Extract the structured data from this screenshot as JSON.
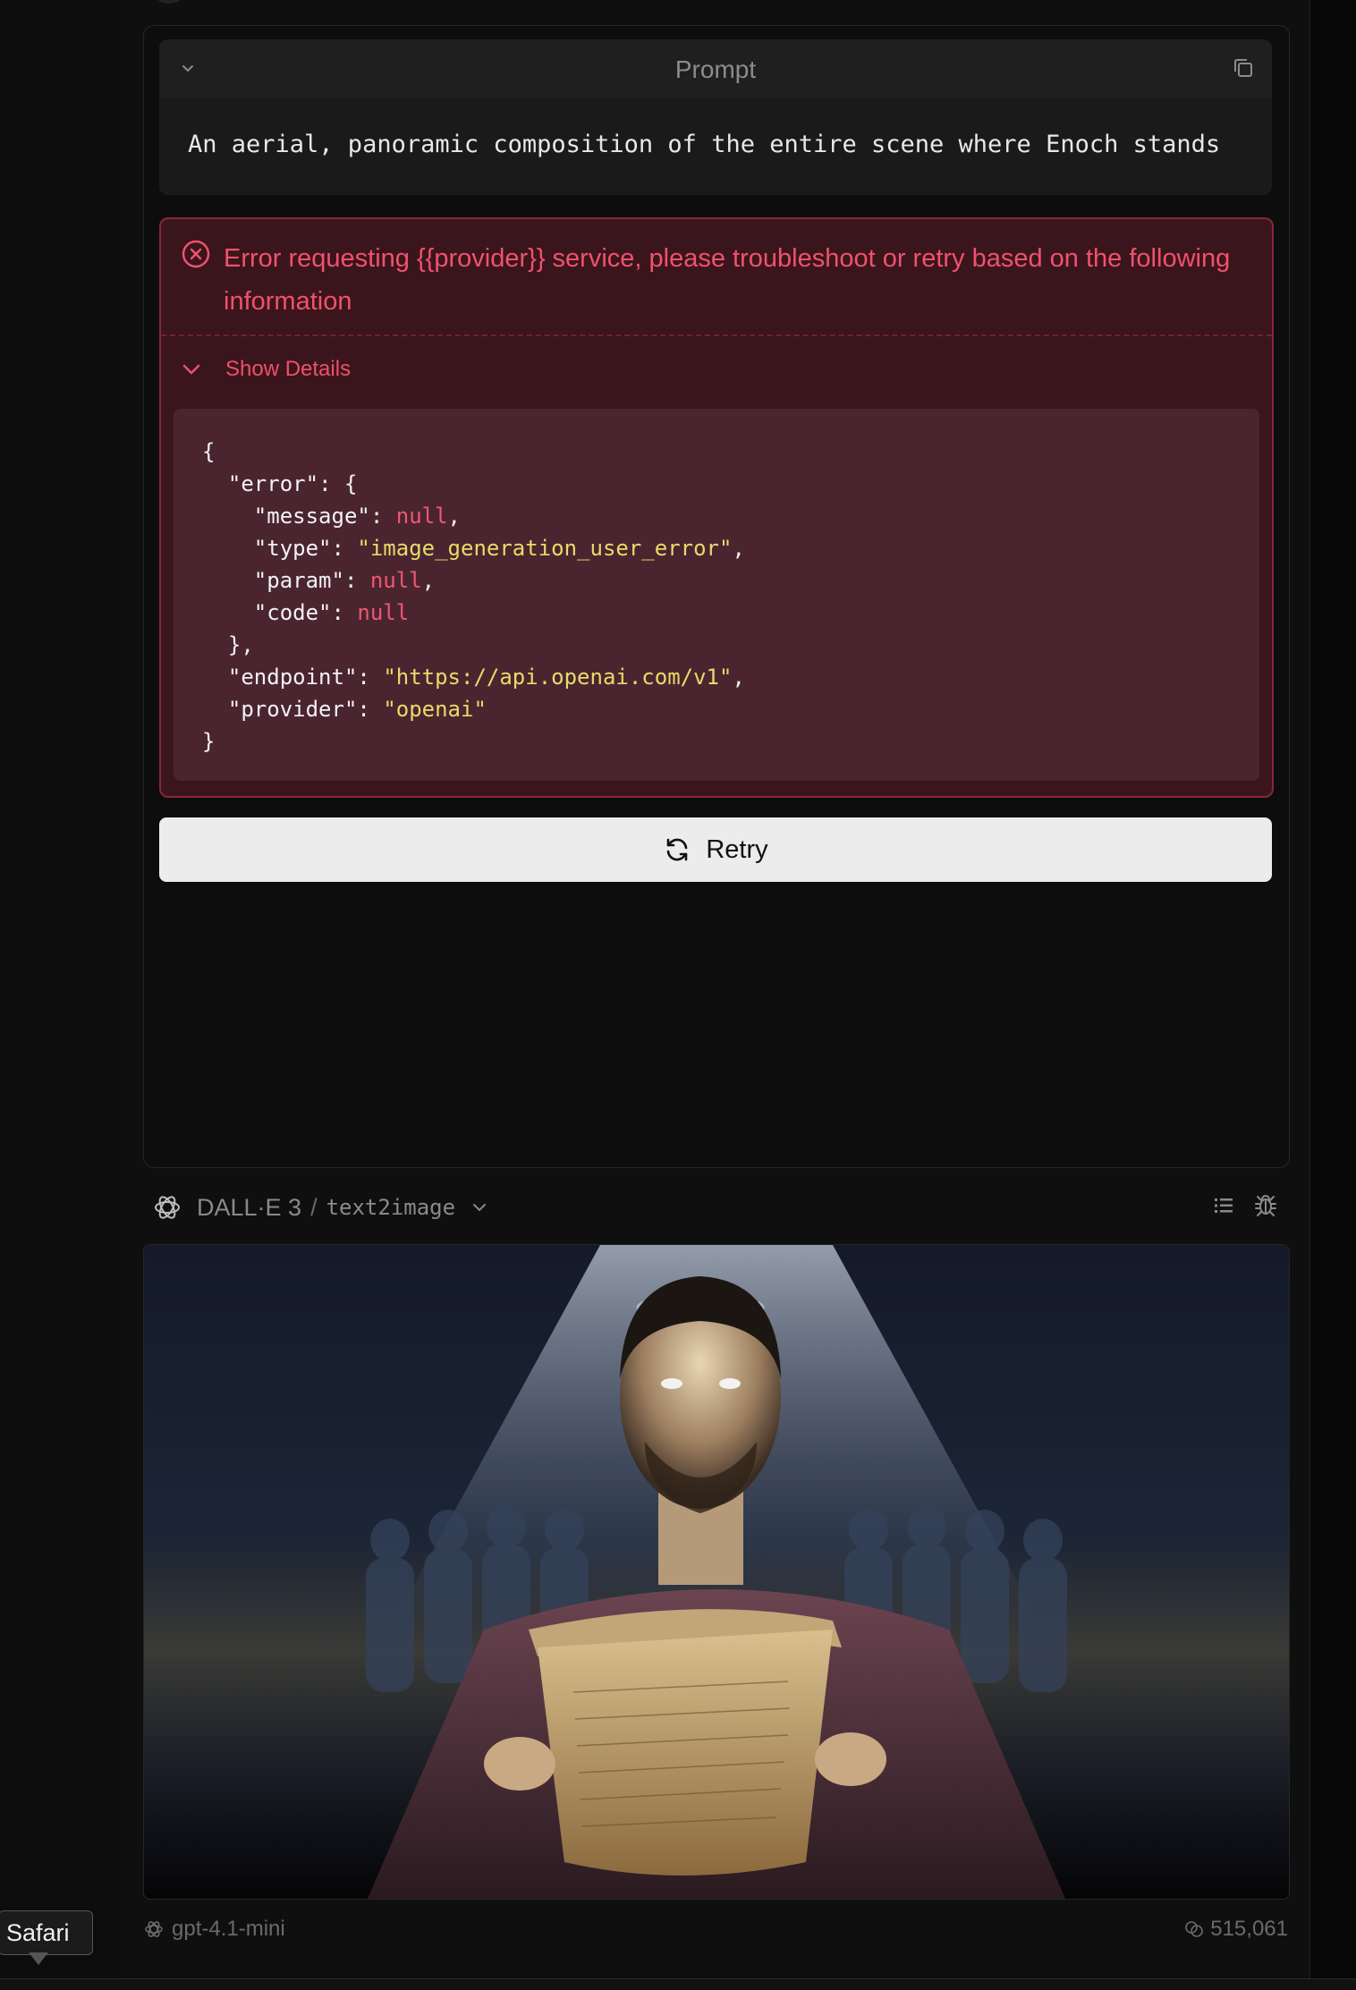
{
  "prompt": {
    "title": "Prompt",
    "text": "An aerial, panoramic composition of the entire scene where Enoch stands"
  },
  "error": {
    "message": "Error requesting {{provider}} service, please troubleshoot or retry based on the following information",
    "details_toggle": "Show Details",
    "json_lines": {
      "l1": "{",
      "l2_key": "\"error\"",
      "l2_rest": ": {",
      "l3_key": "\"message\"",
      "l3_val": "null",
      "l4_key": "\"type\"",
      "l4_val": "\"image_generation_user_error\"",
      "l5_key": "\"param\"",
      "l5_val": "null",
      "l6_key": "\"code\"",
      "l6_val": "null",
      "l7": "},",
      "l8_key": "\"endpoint\"",
      "l8_val": "\"https://api.openai.com/v1\"",
      "l9_key": "\"provider\"",
      "l9_val": "\"openai\"",
      "l10": "}"
    }
  },
  "retry_label": "Retry",
  "generation": {
    "model": "DALL·E 3",
    "separator": "/",
    "mode": "text2image"
  },
  "footer": {
    "model": "gpt-4.1-mini",
    "tokens": "515,061"
  },
  "tooltip": "Safari",
  "colors": {
    "error_text": "#f0516d",
    "error_bg": "#3a151c",
    "json_null": "#ef5673",
    "json_string": "#e6dc68"
  }
}
